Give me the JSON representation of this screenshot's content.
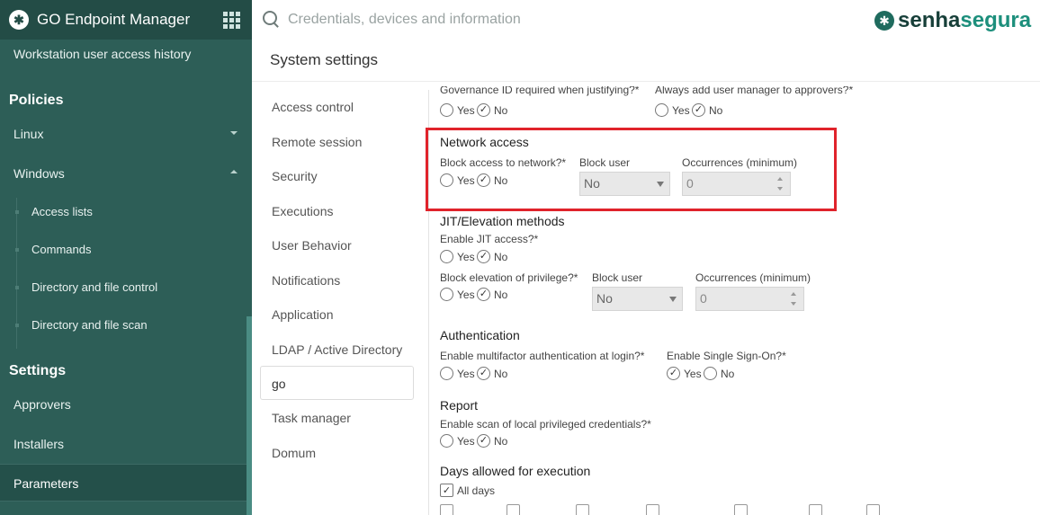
{
  "app": {
    "title": "GO Endpoint Manager",
    "brand_part1": "senha",
    "brand_part2": "segura"
  },
  "search": {
    "placeholder": "Credentials, devices and information"
  },
  "sidebar": {
    "workstation_history": "Workstation user access history",
    "policies_title": "Policies",
    "linux": "Linux",
    "windows": "Windows",
    "windows_items": [
      "Access lists",
      "Commands",
      "Directory and file control",
      "Directory and file scan"
    ],
    "settings_title": "Settings",
    "approvers": "Approvers",
    "installers": "Installers",
    "parameters": "Parameters"
  },
  "page": {
    "title": "System settings"
  },
  "settings_nav": [
    "Access control",
    "Remote session",
    "Security",
    "Executions",
    "User Behavior",
    "Notifications",
    "Application",
    "LDAP / Active Directory",
    "go",
    "Task manager",
    "Domum"
  ],
  "form": {
    "top_label_left": "Governance ID required when justifying?*",
    "top_label_right": "Always add user manager to approvers?*",
    "yes": "Yes",
    "no": "No",
    "network": {
      "title": "Network access",
      "block_label": "Block access to network?*",
      "block_user_label": "Block user",
      "block_user_value": "No",
      "occurrences_label": "Occurrences (minimum)",
      "occurrences_value": "0"
    },
    "jit": {
      "title": "JIT/Elevation methods",
      "enable_label": "Enable JIT access?*",
      "block_label": "Block elevation of privilege?*",
      "block_user_label": "Block user",
      "block_user_value": "No",
      "occurrences_label": "Occurrences (minimum)",
      "occurrences_value": "0"
    },
    "auth": {
      "title": "Authentication",
      "mfa_label": "Enable multifactor authentication at login?*",
      "sso_label": "Enable Single Sign-On?*"
    },
    "report": {
      "title": "Report",
      "scan_label": "Enable scan of local privileged credentials?*"
    },
    "days": {
      "title": "Days allowed for execution",
      "all_days": "All days"
    }
  }
}
